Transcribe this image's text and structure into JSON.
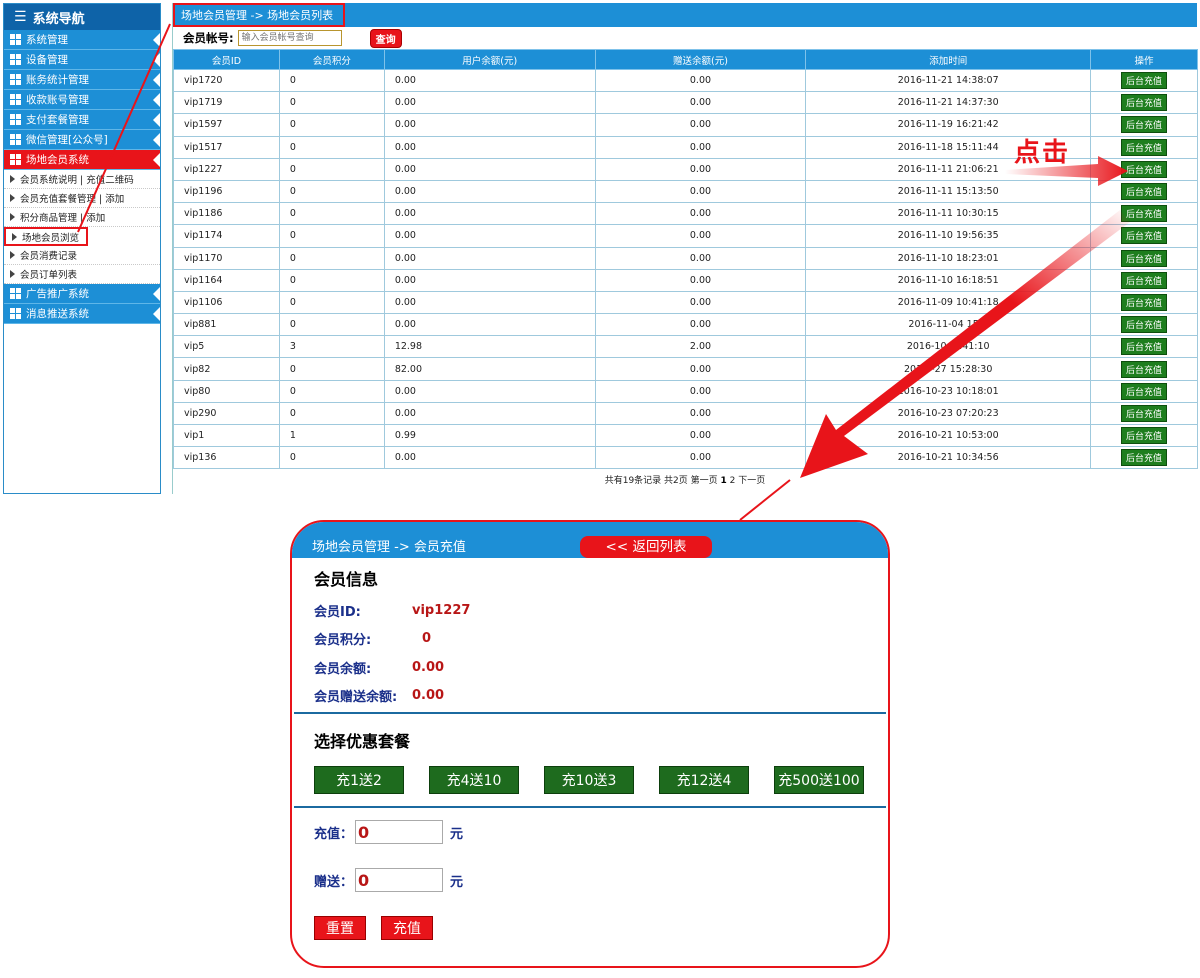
{
  "sidebar": {
    "title": "系统导航",
    "items": [
      {
        "label": "系统管理"
      },
      {
        "label": "设备管理"
      },
      {
        "label": "账务统计管理"
      },
      {
        "label": "收款账号管理"
      },
      {
        "label": "支付套餐管理"
      },
      {
        "label": "微信管理[公众号]"
      },
      {
        "label": "场地会员系统"
      }
    ],
    "subitems": [
      {
        "label": "会员系统说明 | 充值二维码"
      },
      {
        "label": "会员充值套餐管理 | 添加"
      },
      {
        "label": "积分商品管理 | 添加"
      },
      {
        "label": "场地会员浏览"
      },
      {
        "label": "会员消费记录"
      },
      {
        "label": "会员订单列表"
      }
    ],
    "items_after": [
      {
        "label": "广告推广系统"
      },
      {
        "label": "消息推送系统"
      }
    ]
  },
  "main": {
    "breadcrumb": "场地会员管理 -> 场地会员列表",
    "search_label": "会员帐号:",
    "search_placeholder": "输入会员帐号查询",
    "search_button": "查询",
    "columns": [
      "会员ID",
      "会员积分",
      "用户余额(元)",
      "赠送余额(元)",
      "添加时间",
      "操作"
    ],
    "rows": [
      {
        "id": "vip1720",
        "points": "0",
        "balance": "0.00",
        "gift": "0.00",
        "time": "2016-11-21 14:38:07",
        "op": "后台充值"
      },
      {
        "id": "vip1719",
        "points": "0",
        "balance": "0.00",
        "gift": "0.00",
        "time": "2016-11-21 14:37:30",
        "op": "后台充值"
      },
      {
        "id": "vip1597",
        "points": "0",
        "balance": "0.00",
        "gift": "0.00",
        "time": "2016-11-19 16:21:42",
        "op": "后台充值"
      },
      {
        "id": "vip1517",
        "points": "0",
        "balance": "0.00",
        "gift": "0.00",
        "time": "2016-11-18 15:11:44",
        "op": "后台充值"
      },
      {
        "id": "vip1227",
        "points": "0",
        "balance": "0.00",
        "gift": "0.00",
        "time": "2016-11-11 21:06:21",
        "op": "后台充值"
      },
      {
        "id": "vip1196",
        "points": "0",
        "balance": "0.00",
        "gift": "0.00",
        "time": "2016-11-11 15:13:50",
        "op": "后台充值"
      },
      {
        "id": "vip1186",
        "points": "0",
        "balance": "0.00",
        "gift": "0.00",
        "time": "2016-11-11 10:30:15",
        "op": "后台充值"
      },
      {
        "id": "vip1174",
        "points": "0",
        "balance": "0.00",
        "gift": "0.00",
        "time": "2016-11-10 19:56:35",
        "op": "后台充值"
      },
      {
        "id": "vip1170",
        "points": "0",
        "balance": "0.00",
        "gift": "0.00",
        "time": "2016-11-10 18:23:01",
        "op": "后台充值"
      },
      {
        "id": "vip1164",
        "points": "0",
        "balance": "0.00",
        "gift": "0.00",
        "time": "2016-11-10 16:18:51",
        "op": "后台充值"
      },
      {
        "id": "vip1106",
        "points": "0",
        "balance": "0.00",
        "gift": "0.00",
        "time": "2016-11-09 10:41:18",
        "op": "后台充值"
      },
      {
        "id": "vip881",
        "points": "0",
        "balance": "0.00",
        "gift": "0.00",
        "time": "2016-11-04 15:3",
        "op": "后台充值"
      },
      {
        "id": "vip5",
        "points": "3",
        "balance": "12.98",
        "gift": "2.00",
        "time": "2016-10-2 :41:10",
        "op": "后台充值"
      },
      {
        "id": "vip82",
        "points": "0",
        "balance": "82.00",
        "gift": "0.00",
        "time": "201 0-27 15:28:30",
        "op": "后台充值"
      },
      {
        "id": "vip80",
        "points": "0",
        "balance": "0.00",
        "gift": "0.00",
        "time": "2016-10-23 10:18:01",
        "op": "后台充值"
      },
      {
        "id": "vip290",
        "points": "0",
        "balance": "0.00",
        "gift": "0.00",
        "time": "2016-10-23 07:20:23",
        "op": "后台充值"
      },
      {
        "id": "vip1",
        "points": "1",
        "balance": "0.99",
        "gift": "0.00",
        "time": "2016-10-21 10:53:00",
        "op": "后台充值"
      },
      {
        "id": "vip136",
        "points": "0",
        "balance": "0.00",
        "gift": "0.00",
        "time": "2016-10-21 10:34:56",
        "op": "后台充值"
      }
    ],
    "pager": {
      "summary": "共有19条记录 共2页 第一页",
      "page1": "1",
      "page2": "2",
      "next": "下一页"
    }
  },
  "annotation": {
    "click_text": "点击",
    "color": "#e8141a"
  },
  "recharge_panel": {
    "breadcrumb": "场地会员管理 -> 会员充值",
    "back_button": "<< 返回列表",
    "member_info_title": "会员信息",
    "fields": [
      {
        "label": "会员ID:",
        "value": "vip1227"
      },
      {
        "label": "会员积分:",
        "value": "0"
      },
      {
        "label": "会员余额:",
        "value": "0.00"
      },
      {
        "label": "会员赠送余额:",
        "value": "0.00"
      }
    ],
    "package_title": "选择优惠套餐",
    "packages": [
      "充1送2",
      "充4送10",
      "充10送3",
      "充12送4",
      "充500送100"
    ],
    "recharge_label": "充值：",
    "recharge_value": "0",
    "gift_label": "赠送：",
    "gift_value": "0",
    "unit": "元",
    "reset_button": "重置",
    "submit_button": "充值"
  },
  "colors": {
    "nav_blue": "#1d8fd6",
    "active_red": "#e8141a",
    "button_green": "#1e7e1e"
  }
}
